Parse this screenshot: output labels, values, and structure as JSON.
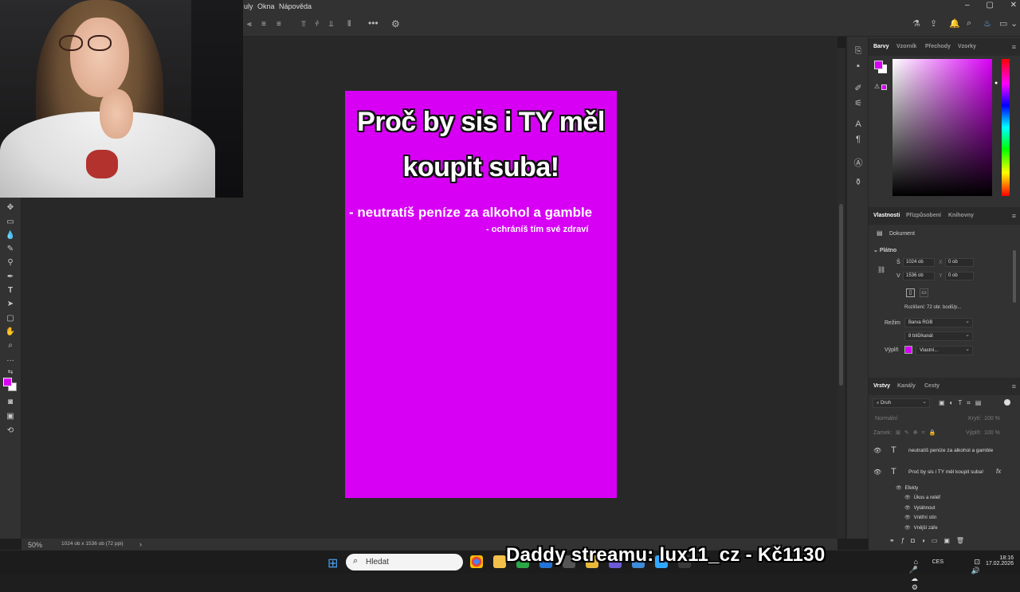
{
  "menubar": {
    "items": [
      "uly",
      "Okna",
      "Nápověda"
    ]
  },
  "window_controls": [
    "–",
    "▢",
    "✕"
  ],
  "canvas": {
    "title": "Proč by sis i TY měl koupit suba!",
    "title_line1": "Proč by sis i TY měl",
    "title_line2": "koupit suba!",
    "line1": "- neutratíš peníze za alkohol a gamble",
    "line2": "- ochráníš tím své zdraví",
    "background_color": "#d700f5"
  },
  "status": {
    "zoom": "50%",
    "doc_info": "1024 ob x 1536 ob (72 ppi)"
  },
  "color_panel": {
    "tabs": [
      "Barvy",
      "Vzorník",
      "Přechody",
      "Vzorky"
    ],
    "active_tab": "Barvy",
    "foreground": "#d700f5",
    "background": "#ffffff"
  },
  "properties_panel": {
    "tabs": [
      "Vlastnosti",
      "Přizpůsobení",
      "Knihovny"
    ],
    "document_label": "Dokument",
    "section": "Plátno",
    "width_label": "Š",
    "width": "1024 ob",
    "height_label": "V",
    "height": "1536 ob",
    "x_label": "X",
    "x_value": "0 ob",
    "y_label": "Y",
    "y_value": "0 ob",
    "resolution": "Rozlišení: 72 obr. bodů/p...",
    "mode_label": "Režim",
    "mode": "Barva RGB",
    "depth": "8 bitů/kanál",
    "fill_label": "Výplň",
    "fill_value": "Vlastní..."
  },
  "layers_panel": {
    "tabs": [
      "Vrstvy",
      "Kanály",
      "Cesty"
    ],
    "filter": "Druh",
    "blend": "Normální",
    "opacity_label": "Krytí:",
    "opacity": "100 %",
    "lock_label": "Zamek:",
    "fill_label": "Výplň:",
    "fill": "100 %",
    "layers": [
      {
        "name": "neutratíš peníze za alkohol a gamble",
        "type": "T"
      },
      {
        "name": "Proč by sis i TY měl koupit suba!",
        "type": "T",
        "fx": "fx"
      }
    ],
    "effects_label": "Efekty",
    "effects": [
      "Úkos a reliéf",
      "Vytáhnout",
      "Vnitřní stín",
      "Vnější záře"
    ]
  },
  "taskbar": {
    "search_placeholder": "Hledat",
    "overlay": "Daddy streamu: lux11_cz - Kč1130",
    "language": "CES",
    "time": "18:16",
    "date": "17.02.2026"
  }
}
